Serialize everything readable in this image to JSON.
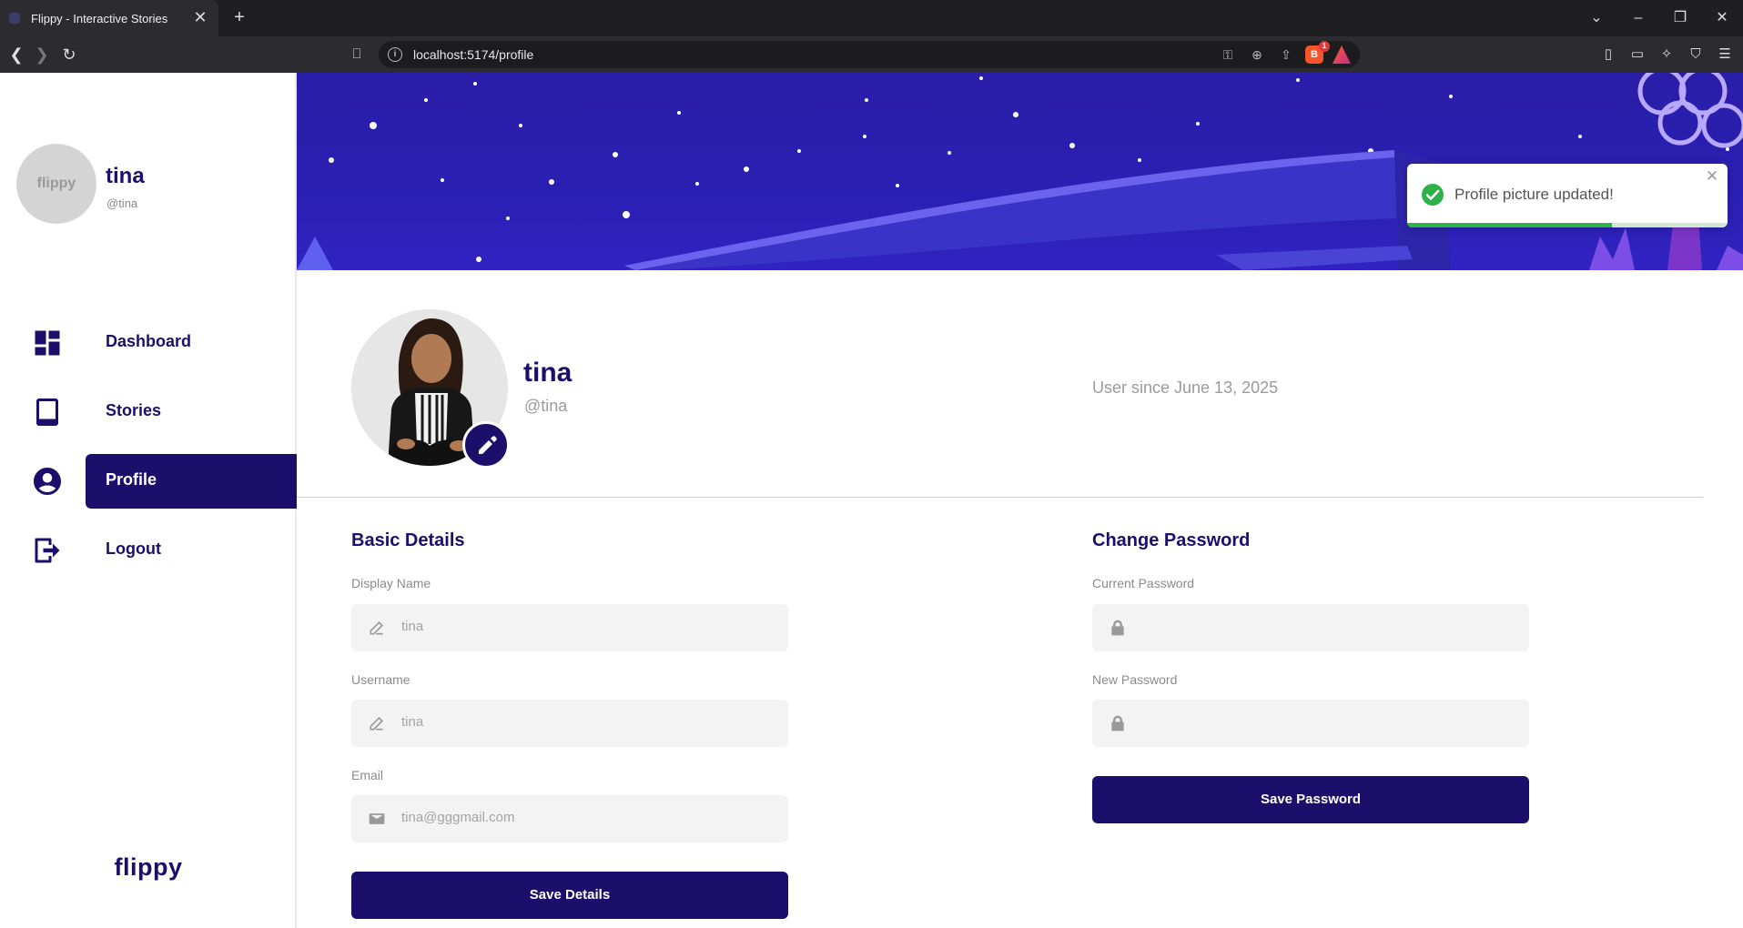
{
  "browser": {
    "tab_title": "Flippy - Interactive Stories",
    "tab_close": "✕",
    "new_tab": "+",
    "url": "localhost:5174/profile",
    "brave_badge": "1",
    "rewards_badge": "1"
  },
  "sidebar": {
    "avatar_text": "flippy",
    "name": "tina",
    "handle": "@tina",
    "items": [
      {
        "label": "Dashboard",
        "icon": "dashboard-icon"
      },
      {
        "label": "Stories",
        "icon": "book-icon"
      },
      {
        "label": "Profile",
        "icon": "account-circle-icon"
      },
      {
        "label": "Logout",
        "icon": "logout-icon"
      }
    ],
    "active_item": "Profile",
    "brand": "flippy"
  },
  "profile": {
    "name": "tina",
    "handle": "@tina",
    "user_since": "User since June 13, 2025"
  },
  "basic_details": {
    "title": "Basic Details",
    "display_name_label": "Display Name",
    "display_name_value": "tina",
    "username_label": "Username",
    "username_value": "tina",
    "email_label": "Email",
    "email_value": "tina@gggmail.com",
    "save_label": "Save Details"
  },
  "change_password": {
    "title": "Change Password",
    "current_label": "Current Password",
    "new_label": "New Password",
    "save_label": "Save Password"
  },
  "toast": {
    "message": "Profile picture updated!",
    "close": "✕",
    "progress": 0.64
  },
  "colors": {
    "brand": "#1c0f6b",
    "banner": "#2a1ea8",
    "success": "#2fb14a"
  }
}
